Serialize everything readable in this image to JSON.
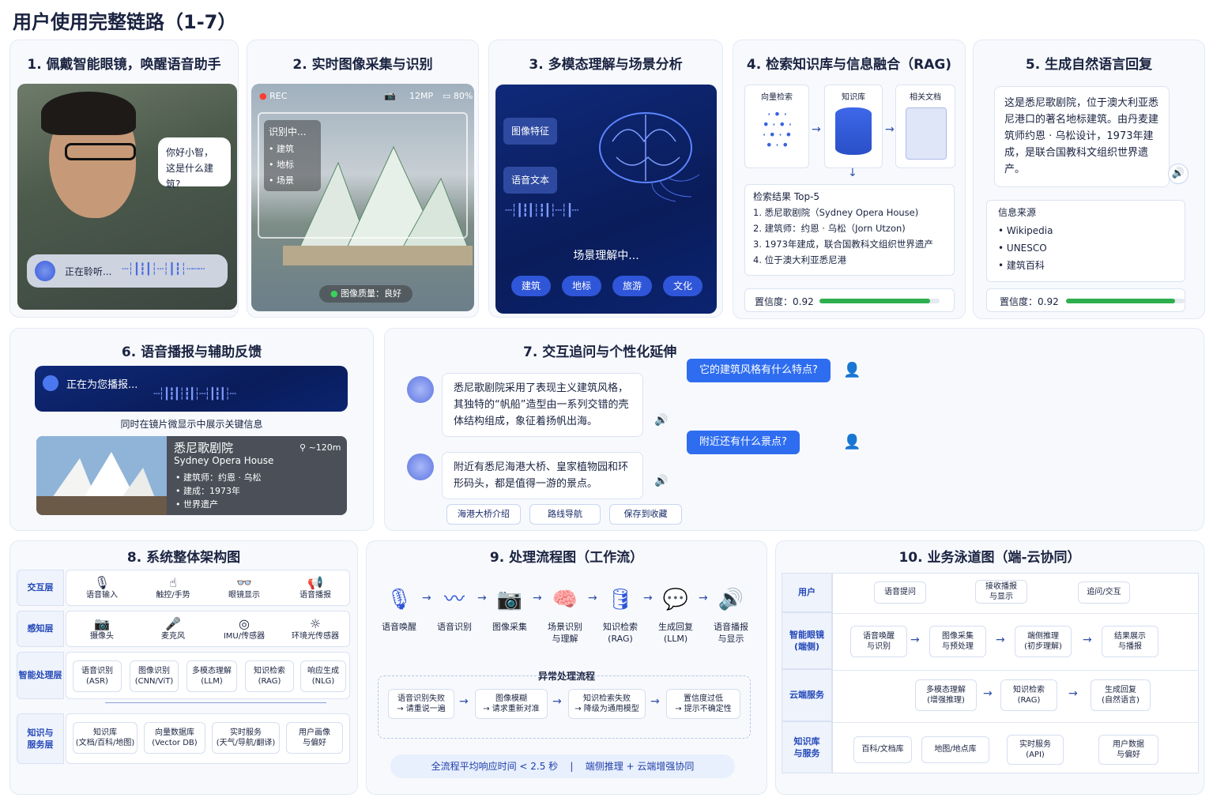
{
  "page_title": "用户使用完整链路（1-7）",
  "s1": {
    "title": "1. 佩戴智能眼镜，唤醒语音助手",
    "bubble": "你好小智，\n这是什么建筑?",
    "listening": "正在聆听..."
  },
  "s2": {
    "title": "2. 实时图像采集与识别",
    "rec": "REC",
    "mp": "12MP",
    "battery": "80%",
    "recognizing": "识别中...",
    "items": [
      "建筑",
      "地标",
      "场景"
    ],
    "quality": "图像质量：良好"
  },
  "s3": {
    "title": "3. 多模态理解与场景分析",
    "feature": "图像特征",
    "voice_text": "语音文本",
    "scene": "场景理解中...",
    "tags": [
      "建筑",
      "地标",
      "旅游",
      "文化"
    ]
  },
  "s4": {
    "title": "4. 检索知识库与信息融合（RAG)",
    "steps": [
      "向量检索",
      "知识库",
      "相关文档"
    ],
    "result_title": "检索结果  Top-5",
    "results": [
      "1. 悉尼歌剧院（Sydney Opera House)",
      "2. 建筑师：约恩 · 乌松（Jorn Utzon)",
      "3. 1973年建成，联合国教科文组织世界遗产",
      "4. 位于澳大利亚悉尼港"
    ],
    "confidence_label": "置信度：",
    "confidence": 0.92
  },
  "s5": {
    "title": "5. 生成自然语言回复",
    "answer": "这是悉尼歌剧院，位于澳大利亚悉尼港口的著名地标建筑。由丹麦建筑师约恩 · 乌松设计，1973年建成，是联合国教科文组织世界遗产。",
    "source_title": "信息来源",
    "sources": [
      "Wikipedia",
      "UNESCO",
      "建筑百科"
    ],
    "confidence_label": "置信度：",
    "confidence": 0.92
  },
  "s6": {
    "title": "6. 语音播报与辅助反馈",
    "speaking": "正在为您播报...",
    "caption": "同时在镜片微显示中展示关键信息",
    "name_cn": "悉尼歌剧院",
    "name_en": "Sydney Opera House",
    "distance": "~120m",
    "facts": [
      "建筑师：约恩 · 乌松",
      "建成：1973年",
      "世界遗产"
    ]
  },
  "s7": {
    "title": "7. 交互追问与个性化延伸",
    "q1": "它的建筑风格有什么特点?",
    "a1": "悉尼歌剧院采用了表现主义建筑风格，其独特的“帆船”造型由一系列交错的壳体结构组成，象征着扬帆出海。",
    "q2": "附近还有什么景点?",
    "a2": "附近有悉尼海港大桥、皇家植物园和环形码头，都是值得一游的景点。",
    "buttons": [
      "海港大桥介绍",
      "路线导航",
      "保存到收藏"
    ]
  },
  "s8": {
    "title": "8. 系统整体架构图",
    "layers": [
      {
        "name": "交互层",
        "items": [
          "语音输入",
          "触控/手势",
          "眼镜显示",
          "语音播报"
        ],
        "icons": [
          "🎙",
          "☝",
          "👓",
          "📢"
        ]
      },
      {
        "name": "感知层",
        "items": [
          "摄像头",
          "麦克风",
          "IMU/传感器",
          "环境光传感器"
        ],
        "icons": [
          "📷",
          "🎤",
          "◎",
          "☼"
        ]
      },
      {
        "name": "智能处理层",
        "items": [
          "语音识别\n(ASR)",
          "图像识别\n(CNN/ViT)",
          "多模态理解\n(LLM)",
          "知识检索\n(RAG)",
          "响应生成\n(NLG)"
        ]
      },
      {
        "name": "知识与\n服务层",
        "items": [
          "知识库\n(文档/百科/地图)",
          "向量数据库\n(Vector DB)",
          "实时服务\n(天气/导航/翻译)",
          "用户画像\n与偏好"
        ]
      }
    ]
  },
  "s9": {
    "title": "9. 处理流程图（工作流）",
    "steps": [
      "语音唤醒",
      "语音识别",
      "图像采集",
      "场景识别\n与理解",
      "知识检索\n(RAG)",
      "生成回复\n(LLM)",
      "语音播报\n与显示"
    ],
    "icons": [
      "🎙",
      "〰",
      "📷",
      "🧠",
      "🛢",
      "💬",
      "🔊"
    ],
    "exc_title": "异常处理流程",
    "exceptions": [
      "语音识别失败\n→ 请重说一遍",
      "图像模糊\n→ 请求重新对准",
      "知识检索失败\n→ 降级为通用模型",
      "置信度过低\n→ 提示不确定性"
    ],
    "footer": "全流程平均响应时间 < 2.5 秒    |    端侧推理 + 云端增强协同"
  },
  "s10": {
    "title": "10. 业务泳道图（端-云协同）",
    "lanes": [
      "用户",
      "智能眼镜\n(端侧)",
      "云端服务",
      "知识库\n与服务"
    ],
    "user": [
      "语音提问",
      "接收播报\n与显示",
      "追问/交互"
    ],
    "edge": [
      "语音唤醒\n与识别",
      "图像采集\n与预处理",
      "端侧推理\n(初步理解)",
      "结果展示\n与播报"
    ],
    "cloud": [
      "多模态理解\n(增强推理)",
      "知识检索\n(RAG)",
      "生成回复\n(自然语言)"
    ],
    "kb": [
      "百科/文档库",
      "地图/地点库",
      "实时服务\n(API)",
      "用户数据\n与偏好"
    ]
  }
}
